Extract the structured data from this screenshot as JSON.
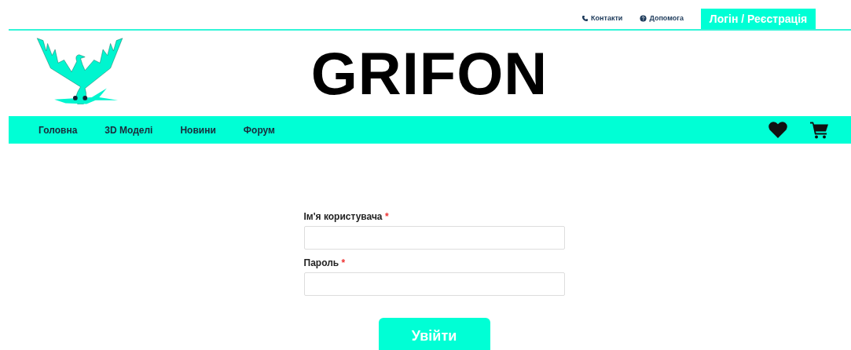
{
  "top_links": [
    {
      "kind": "phone",
      "label": "Контакти"
    },
    {
      "kind": "help",
      "label": "Допомога"
    }
  ],
  "login_button": "Логін / Реєстрація",
  "logo_text": "GRIFON",
  "nav": [
    "Головна",
    "3D Моделі",
    "Новини",
    "Форум"
  ],
  "form": {
    "fields": [
      {
        "label": "Ім'я користувача",
        "required_mark": "*"
      },
      {
        "label": "Пароль",
        "required_mark": "*"
      }
    ],
    "submit": "Увійти"
  }
}
